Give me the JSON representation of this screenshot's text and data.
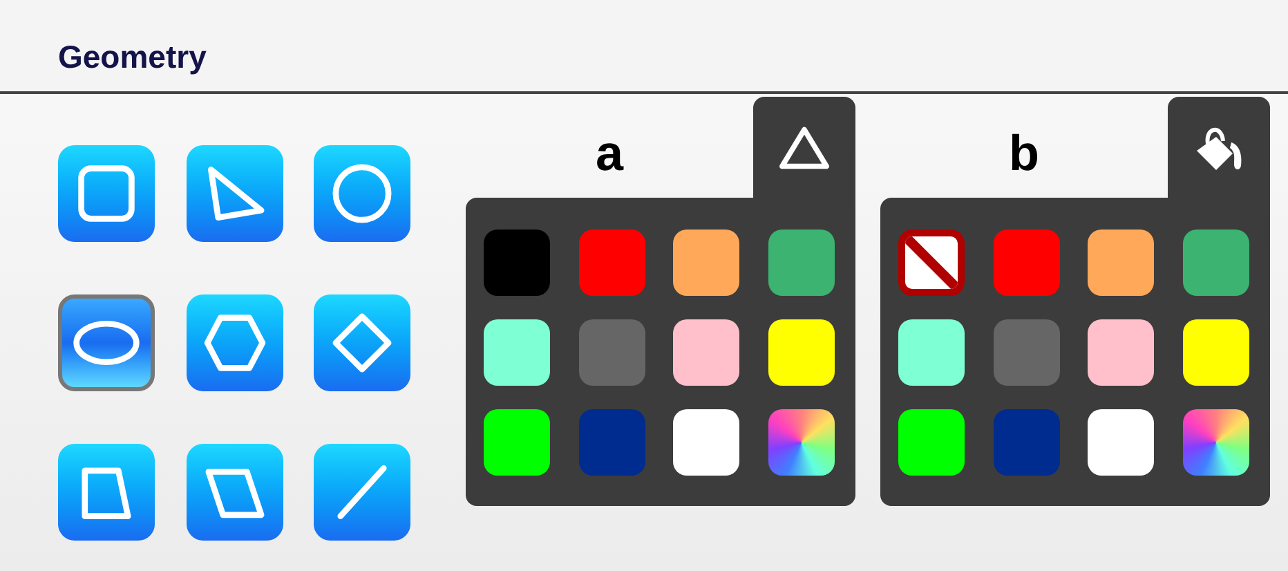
{
  "section": {
    "title": "Geometry"
  },
  "shapes": [
    {
      "kind": "square",
      "selected": false
    },
    {
      "kind": "triangle",
      "selected": false
    },
    {
      "kind": "circle",
      "selected": false
    },
    {
      "kind": "ellipse",
      "selected": true
    },
    {
      "kind": "hexagon",
      "selected": false
    },
    {
      "kind": "diamond",
      "selected": false
    },
    {
      "kind": "trapezoid",
      "selected": false
    },
    {
      "kind": "parallelogram",
      "selected": false
    },
    {
      "kind": "line",
      "selected": false
    }
  ],
  "palettes": [
    {
      "label": "a",
      "tab": {
        "kind": "outline"
      },
      "swatches": [
        {
          "kind": "color",
          "color": "#000000"
        },
        {
          "kind": "color",
          "color": "#ff0000"
        },
        {
          "kind": "color",
          "color": "#ffa85a"
        },
        {
          "kind": "color",
          "color": "#3cb371"
        },
        {
          "kind": "color",
          "color": "#7fffd4"
        },
        {
          "kind": "color",
          "color": "#666666"
        },
        {
          "kind": "color",
          "color": "#ffc0cb"
        },
        {
          "kind": "color",
          "color": "#ffff00"
        },
        {
          "kind": "color",
          "color": "#00ff00"
        },
        {
          "kind": "color",
          "color": "#002b8f"
        },
        {
          "kind": "color",
          "color": "#ffffff"
        },
        {
          "kind": "spectrum"
        }
      ]
    },
    {
      "label": "b",
      "tab": {
        "kind": "fill"
      },
      "swatches": [
        {
          "kind": "none"
        },
        {
          "kind": "color",
          "color": "#ff0000"
        },
        {
          "kind": "color",
          "color": "#ffa85a"
        },
        {
          "kind": "color",
          "color": "#3cb371"
        },
        {
          "kind": "color",
          "color": "#7fffd4"
        },
        {
          "kind": "color",
          "color": "#666666"
        },
        {
          "kind": "color",
          "color": "#ffc0cb"
        },
        {
          "kind": "color",
          "color": "#ffff00"
        },
        {
          "kind": "color",
          "color": "#00ff00"
        },
        {
          "kind": "color",
          "color": "#002b8f"
        },
        {
          "kind": "color",
          "color": "#ffffff"
        },
        {
          "kind": "spectrum"
        }
      ]
    }
  ]
}
